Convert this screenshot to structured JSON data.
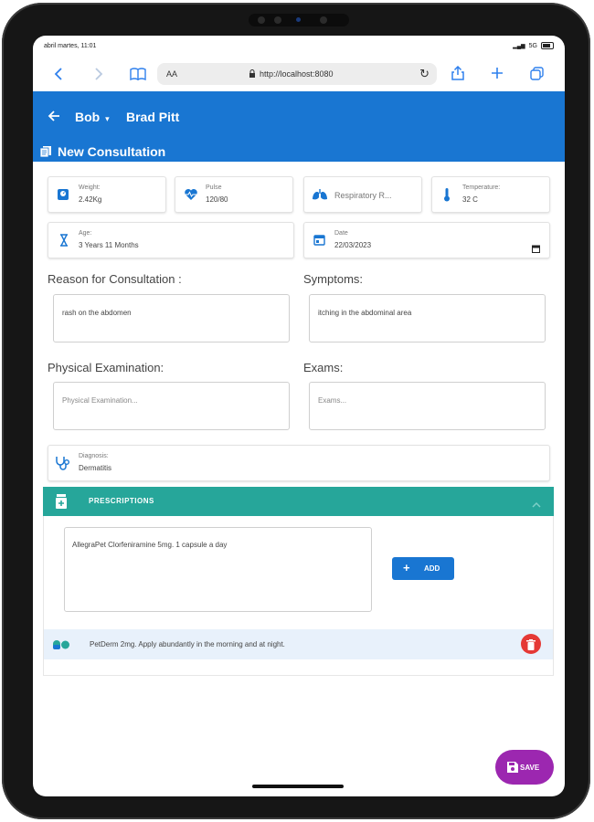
{
  "status": {
    "time": "abril martes, 11:01",
    "network": "5G"
  },
  "browser": {
    "text_size": "AA",
    "url": "http://localhost:8080"
  },
  "header": {
    "patient": "Bob",
    "owner": "Brad Pitt",
    "section_title": "New Consultation"
  },
  "vitals": {
    "weight": {
      "label": "Weight:",
      "value": "2.42Kg"
    },
    "pulse": {
      "label": "Pulse",
      "value": "120/80"
    },
    "respiratory": {
      "label": "Respiratory R..."
    },
    "temperature": {
      "label": "Temperature:",
      "value": "32 C"
    },
    "age": {
      "label": "Age:",
      "value": "3 Years 11 Months"
    },
    "date": {
      "label": "Date",
      "value": "22/03/2023"
    }
  },
  "reason": {
    "title": "Reason for Consultation :",
    "value": "rash on the abdomen"
  },
  "symptoms": {
    "title": "Symptoms:",
    "value": "itching in the abdominal area"
  },
  "physical": {
    "title": "Physical Examination:",
    "placeholder": "Physical Examination..."
  },
  "exams": {
    "title": "Exams:",
    "placeholder": "Exams..."
  },
  "diagnosis": {
    "label": "Diagnosis:",
    "value": "Dermatitis"
  },
  "prescriptions": {
    "title": "PRESCRIPTIONS",
    "input_value": "AllegraPet Clorfeniramine 5mg. 1 capsule a day",
    "add_label": "ADD",
    "items": [
      {
        "text": "PetDerm 2mg. Apply abundantly in the morning and at night."
      }
    ]
  },
  "save_label": "SAVE",
  "colors": {
    "primary": "#1976d2",
    "teal": "#26a69a",
    "fab": "#9c27b0",
    "delete": "#e53935"
  }
}
